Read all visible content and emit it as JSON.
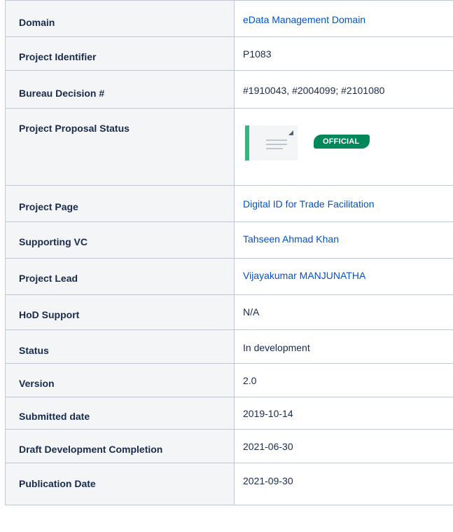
{
  "rows": [
    {
      "label": "Domain",
      "value": "eData Management Domain",
      "link": true
    },
    {
      "label": "Project Identifier",
      "value": "P1083",
      "link": false
    },
    {
      "label": "Bureau Decision #",
      "value": "#1910043, #2004099; #2101080",
      "link": false
    },
    {
      "label": "Project Proposal Status",
      "status_badge": "OFFICIAL"
    },
    {
      "label": "Project Page",
      "value": "Digital ID for Trade Facilitation",
      "link": true
    },
    {
      "label": "Supporting VC",
      "value": "Tahseen Ahmad Khan",
      "link": true
    },
    {
      "label": "Project Lead",
      "value": "Vijayakumar MANJUNATHA",
      "link": true
    },
    {
      "label": "HoD Support",
      "value": "N/A",
      "link": false
    },
    {
      "label": "Status",
      "value": "In development",
      "link": false
    },
    {
      "label": "Version",
      "value": "2.0",
      "link": false
    },
    {
      "label": "Submitted date",
      "value": "2019-10-14",
      "link": false
    },
    {
      "label": "Draft Development Completion",
      "value": "2021-06-30",
      "link": false
    },
    {
      "label": "Publication Date",
      "value": "2021-09-30",
      "link": false
    }
  ],
  "colors": {
    "link": "#0052cc",
    "badge": "#00875a",
    "header_bg": "#f4f5f7",
    "border": "#c1c7d0"
  },
  "icons": {
    "document": "document-thumbnail-icon"
  }
}
